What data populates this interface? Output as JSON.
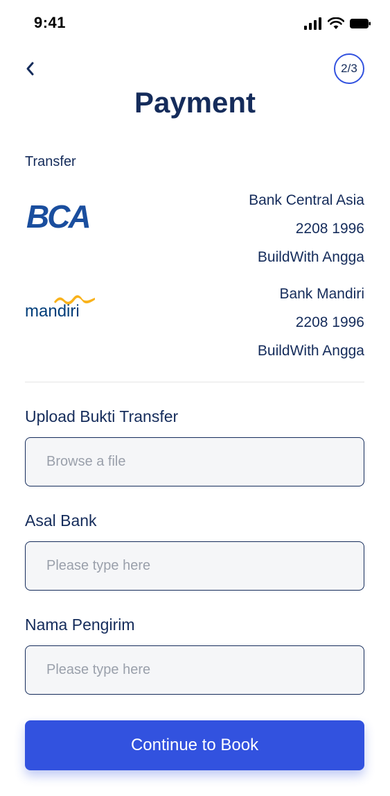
{
  "status_bar": {
    "time": "9:41",
    "icons": [
      "signal-icon",
      "wifi-icon",
      "battery-icon"
    ]
  },
  "header": {
    "back_icon": "chevron-left-icon",
    "step": "2/3",
    "title": "Payment"
  },
  "transfer": {
    "label": "Transfer",
    "banks": [
      {
        "logo_text": "BCA",
        "bank_name": "Bank Central Asia",
        "account_number": "2208 1996",
        "account_holder": "BuildWith Angga",
        "logo_color": "#1a4e9e"
      },
      {
        "logo_text": "mandiri",
        "bank_name": "Bank Mandiri",
        "account_number": "2208 1996",
        "account_holder": "BuildWith Angga",
        "logo_color": "#003d79",
        "logo_accent": "#f9b21b"
      }
    ]
  },
  "form": {
    "upload": {
      "label": "Upload Bukti Transfer",
      "placeholder": "Browse a file"
    },
    "origin_bank": {
      "label": "Asal Bank",
      "placeholder": "Please type here"
    },
    "sender_name": {
      "label": "Nama Pengirim",
      "placeholder": "Please type here"
    }
  },
  "actions": {
    "continue_label": "Continue to Book"
  },
  "colors": {
    "primary": "#3252df",
    "text": "#152c5b",
    "input_bg": "#f5f6f8",
    "placeholder": "#9aa0ab"
  }
}
